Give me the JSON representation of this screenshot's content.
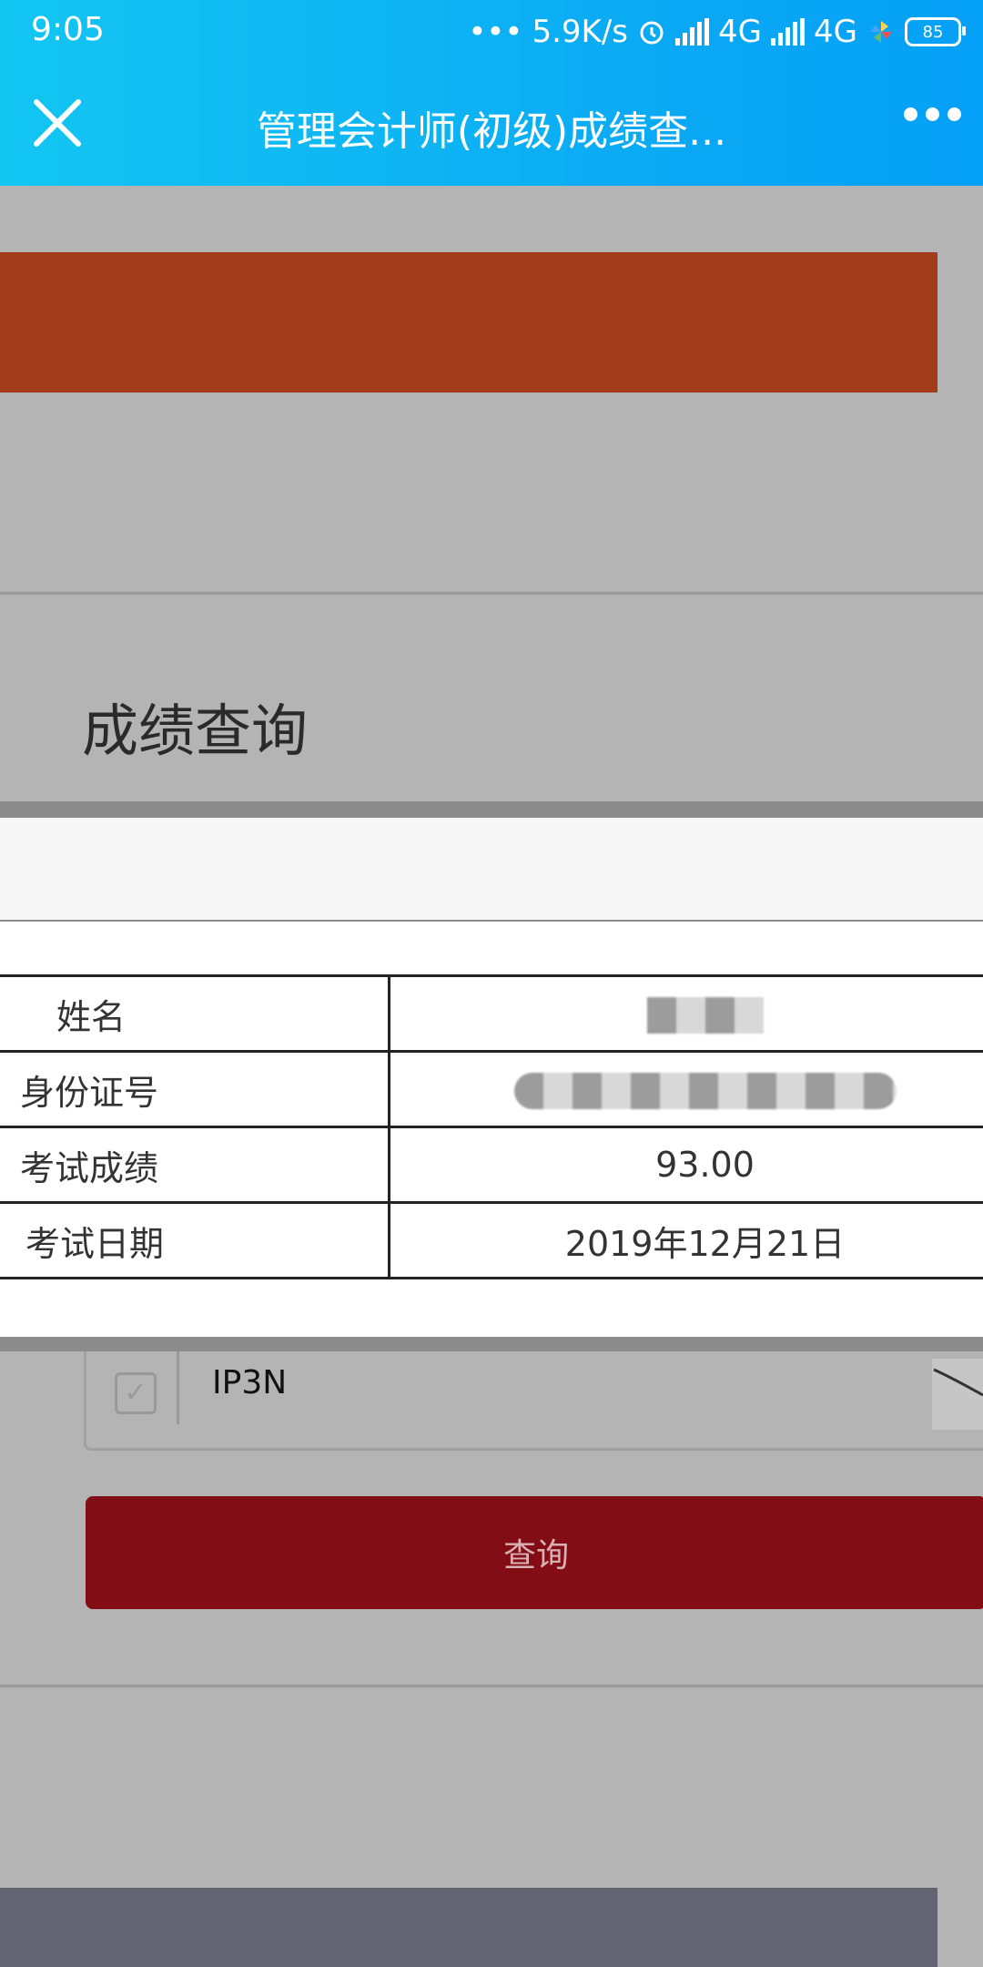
{
  "status_bar": {
    "time": "9:05",
    "dots": "•••",
    "speed": "5.9K/s",
    "network1": "4G",
    "network2": "4G",
    "battery": "85"
  },
  "nav": {
    "title": "管理会计师(初级)成绩查..."
  },
  "page": {
    "heading": "成绩查询",
    "captcha_code": "IP3N",
    "query_button": "查询"
  },
  "result": {
    "rows": [
      {
        "label": "姓名",
        "value": ""
      },
      {
        "label": "身份证号",
        "value": ""
      },
      {
        "label": "考试成绩",
        "value": "93.00"
      },
      {
        "label": "考试日期",
        "value": "2019年12月21日"
      }
    ]
  },
  "colors": {
    "nav_gradient_start": "#13c6f2",
    "nav_gradient_end": "#05a0f7",
    "banner": "#a33c1a",
    "query_button": "#820d15",
    "overlay_bg": "#b4b4b4"
  }
}
